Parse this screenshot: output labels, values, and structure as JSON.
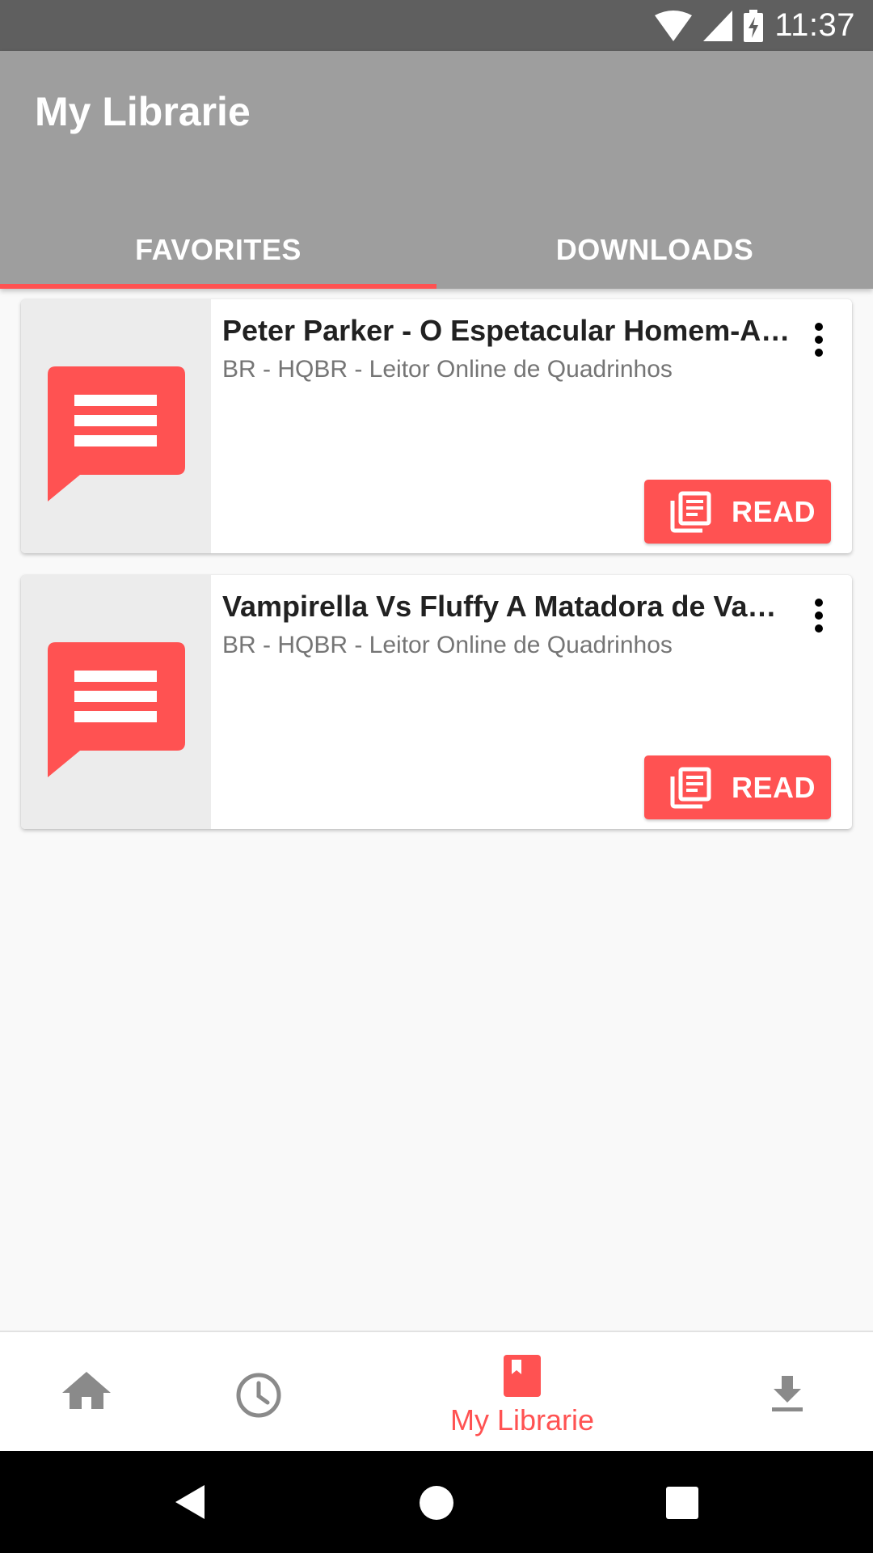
{
  "status_bar": {
    "time": "11:37"
  },
  "app_bar": {
    "title": "My Librarie"
  },
  "tabs": [
    {
      "label": "FAVORITES",
      "selected": true
    },
    {
      "label": "DOWNLOADS",
      "selected": false
    }
  ],
  "favorites": [
    {
      "title": "Peter Parker - O Espetacular Homem-Ar...",
      "source": "BR - HQBR - Leitor Online de Quadrinhos",
      "action_label": "READ"
    },
    {
      "title": "Vampirella Vs Fluffy A Matadora de Vam...",
      "source": "BR - HQBR - Leitor Online de Quadrinhos",
      "action_label": "READ"
    }
  ],
  "bottom_nav": {
    "items": [
      {
        "icon": "home-icon",
        "label": ""
      },
      {
        "icon": "history-icon",
        "label": ""
      },
      {
        "icon": "library-icon",
        "label": "My Librarie",
        "selected": true
      },
      {
        "icon": "download-icon",
        "label": ""
      }
    ]
  },
  "colors": {
    "accent": "#ff5252",
    "app_bar": "#9e9e9e",
    "status_bar": "#5f5f5f",
    "thumbnail_bg": "#ececec"
  }
}
